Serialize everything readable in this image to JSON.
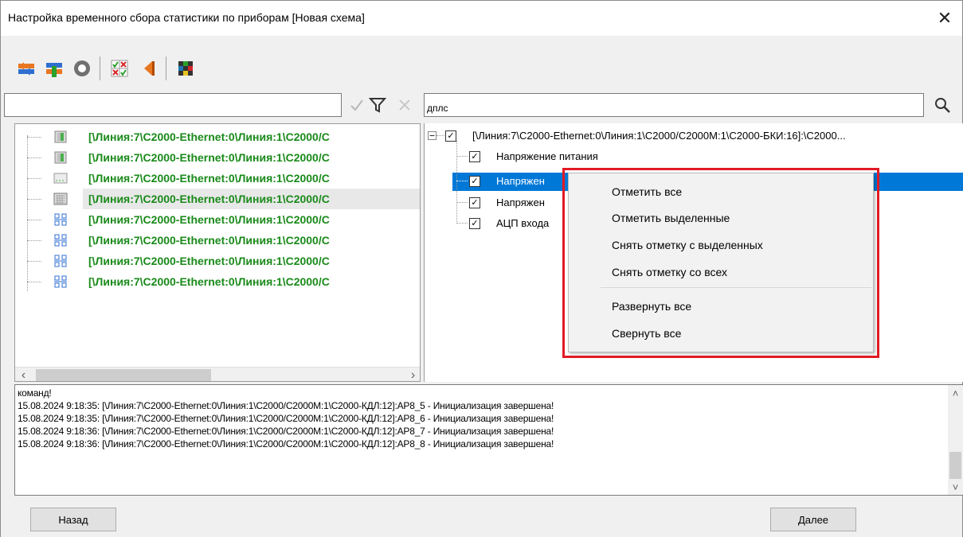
{
  "window": {
    "title": "Настройка временного сбора статистики по приборам [Новая схема]",
    "close_glyph": "✕"
  },
  "toolbar": {
    "buttons": [
      {
        "icon": "refresh-orange-icon"
      },
      {
        "icon": "refresh-green-icon"
      },
      {
        "icon": "stop-circle-icon"
      },
      {
        "icon": "checklist-icon"
      },
      {
        "icon": "arrow-left-orange-icon"
      },
      {
        "icon": "palette-grid-icon"
      }
    ]
  },
  "filter": {
    "value": "",
    "icons": [
      "apply-check-icon",
      "filter-funnel-icon",
      "clear-filter-icon"
    ]
  },
  "search": {
    "value": "дплс"
  },
  "left_tree": {
    "items": [
      {
        "label": "[\\Линия:7\\C2000-Ethernet:0\\Линия:1\\C2000/С",
        "icon": "device-icon"
      },
      {
        "label": "[\\Линия:7\\C2000-Ethernet:0\\Линия:1\\C2000/С",
        "icon": "device-icon"
      },
      {
        "label": "[\\Линия:7\\C2000-Ethernet:0\\Линия:1\\C2000/С",
        "icon": "panel-icon"
      },
      {
        "label": "[\\Линия:7\\C2000-Ethernet:0\\Линия:1\\C2000/С",
        "icon": "keypad-icon"
      },
      {
        "label": "[\\Линия:7\\C2000-Ethernet:0\\Линия:1\\C2000/С",
        "icon": "network-icon"
      },
      {
        "label": "[\\Линия:7\\C2000-Ethernet:0\\Линия:1\\C2000/С",
        "icon": "network-icon"
      },
      {
        "label": "[\\Линия:7\\C2000-Ethernet:0\\Линия:1\\C2000/С",
        "icon": "network-icon"
      },
      {
        "label": "[\\Линия:7\\C2000-Ethernet:0\\Линия:1\\C2000/С",
        "icon": "network-icon"
      }
    ]
  },
  "right_tree": {
    "root_label": "[\\Линия:7\\C2000-Ethernet:0\\Линия:1\\C2000/C2000M:1\\C2000-БКИ:16]:\\C2000...",
    "children": [
      {
        "label": "Напряжение питания"
      },
      {
        "label": "Напряжен"
      },
      {
        "label": "Напряжен"
      },
      {
        "label": "АЦП входа"
      }
    ]
  },
  "context_menu": {
    "items": [
      "Отметить все",
      "Отметить выделенные",
      "Снять отметку с выделенных",
      "Снять отметку со всех",
      "Развернуть все",
      "Свернуть все"
    ]
  },
  "log": {
    "lines": [
      "команд!",
      "15.08.2024 9:18:35: [\\Линия:7\\C2000-Ethernet:0\\Линия:1\\C2000/C2000M:1\\C2000-КДЛ:12]:АР8_5 - Инициализация завершена!",
      "15.08.2024 9:18:35: [\\Линия:7\\C2000-Ethernet:0\\Линия:1\\C2000/C2000M:1\\C2000-КДЛ:12]:АР8_6 - Инициализация завершена!",
      "15.08.2024 9:18:36: [\\Линия:7\\C2000-Ethernet:0\\Линия:1\\C2000/C2000M:1\\C2000-КДЛ:12]:АР8_7 - Инициализация завершена!",
      "15.08.2024 9:18:36: [\\Линия:7\\C2000-Ethernet:0\\Линия:1\\C2000/C2000M:1\\C2000-КДЛ:12]:АР8_8 - Инициализация завершена!"
    ]
  },
  "buttons": {
    "back_label": "Назад",
    "next_label": "Далее"
  },
  "colors": {
    "tree_text": "#1a8a1a",
    "selection": "#0078d7",
    "highlight_frame": "#e01b24"
  }
}
